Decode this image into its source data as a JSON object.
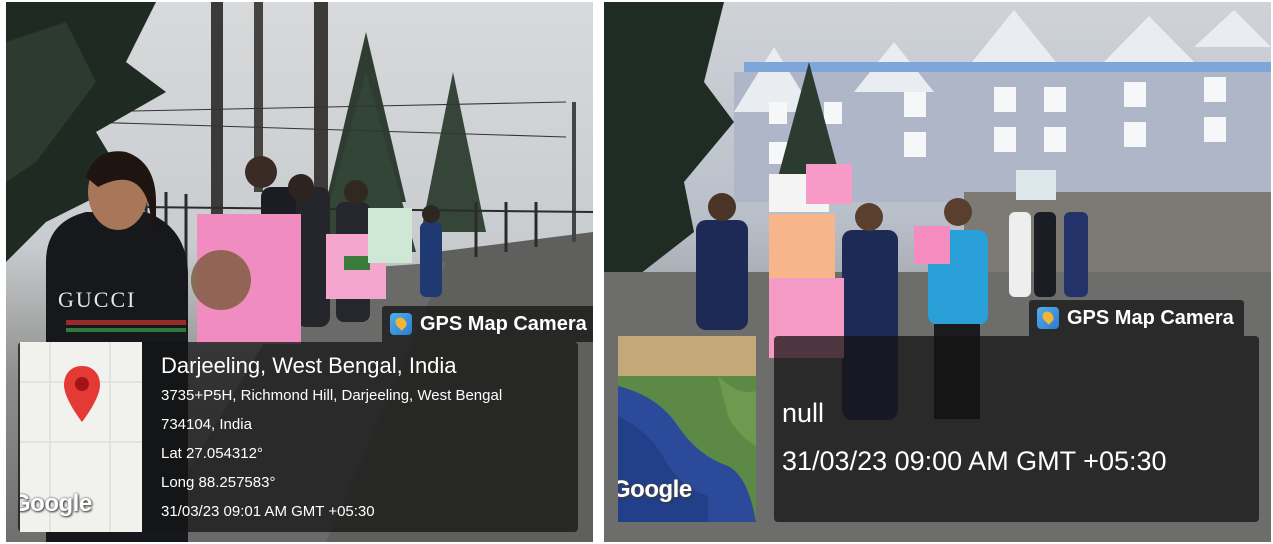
{
  "left": {
    "camera_tag": "GPS Map Camera",
    "map_brand": "Google",
    "location": "Darjeeling, West Bengal, India",
    "address_line1": "3735+P5H, Richmond Hill, Darjeeling, West Bengal",
    "address_line2": "734104, India",
    "lat": "Lat 27.054312°",
    "long": "Long 88.257583°",
    "datetime": "31/03/23 09:01 AM GMT +05:30",
    "shirt_text": "GUCCI"
  },
  "right": {
    "camera_tag": "GPS Map Camera",
    "map_brand": "Google",
    "location": "null",
    "datetime": "31/03/23 09:00 AM GMT +05:30"
  },
  "colors": {
    "overlay": "#141414",
    "pin": "#e53935",
    "poster_pink": "#f08cc0"
  },
  "icons": [
    "gps-camera-icon",
    "map-pin-icon"
  ]
}
